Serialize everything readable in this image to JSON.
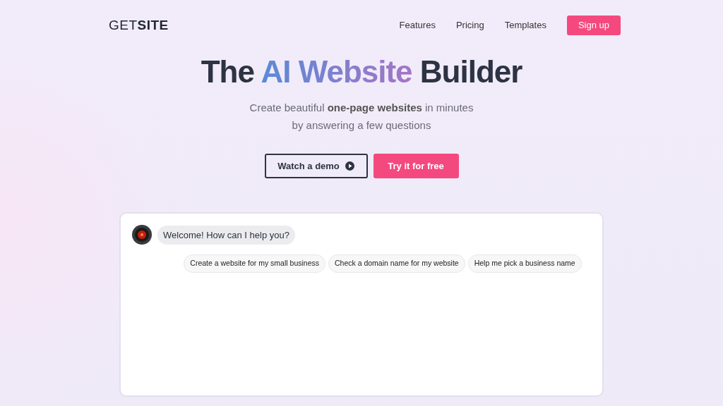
{
  "logo": "GET**SITE**",
  "nav": [
    {
      "label": "Features",
      "kind": "link"
    },
    {
      "label": "Pricing",
      "kind": "link"
    },
    {
      "label": "Templates",
      "kind": "link"
    },
    {
      "label": "Sign up",
      "kind": "button"
    }
  ],
  "headline": [
    {
      "text": "The ",
      "highlight": false
    },
    {
      "text": "AI Website",
      "highlight": true
    },
    {
      "text": " Builder",
      "highlight": false
    }
  ],
  "subtitle": "Create beautiful **one-page websites** in minutes by answering a few questions",
  "buttons": [
    {
      "label": "Watch a demo",
      "kind": "outline"
    },
    {
      "label": "Try it for free",
      "kind": "primary"
    }
  ],
  "chat": {
    "message": "Welcome! How can I help you?",
    "suggestions": [
      "Create a website for my small business",
      "Check a domain name for my website",
      "Help me pick a business name"
    ]
  }
}
